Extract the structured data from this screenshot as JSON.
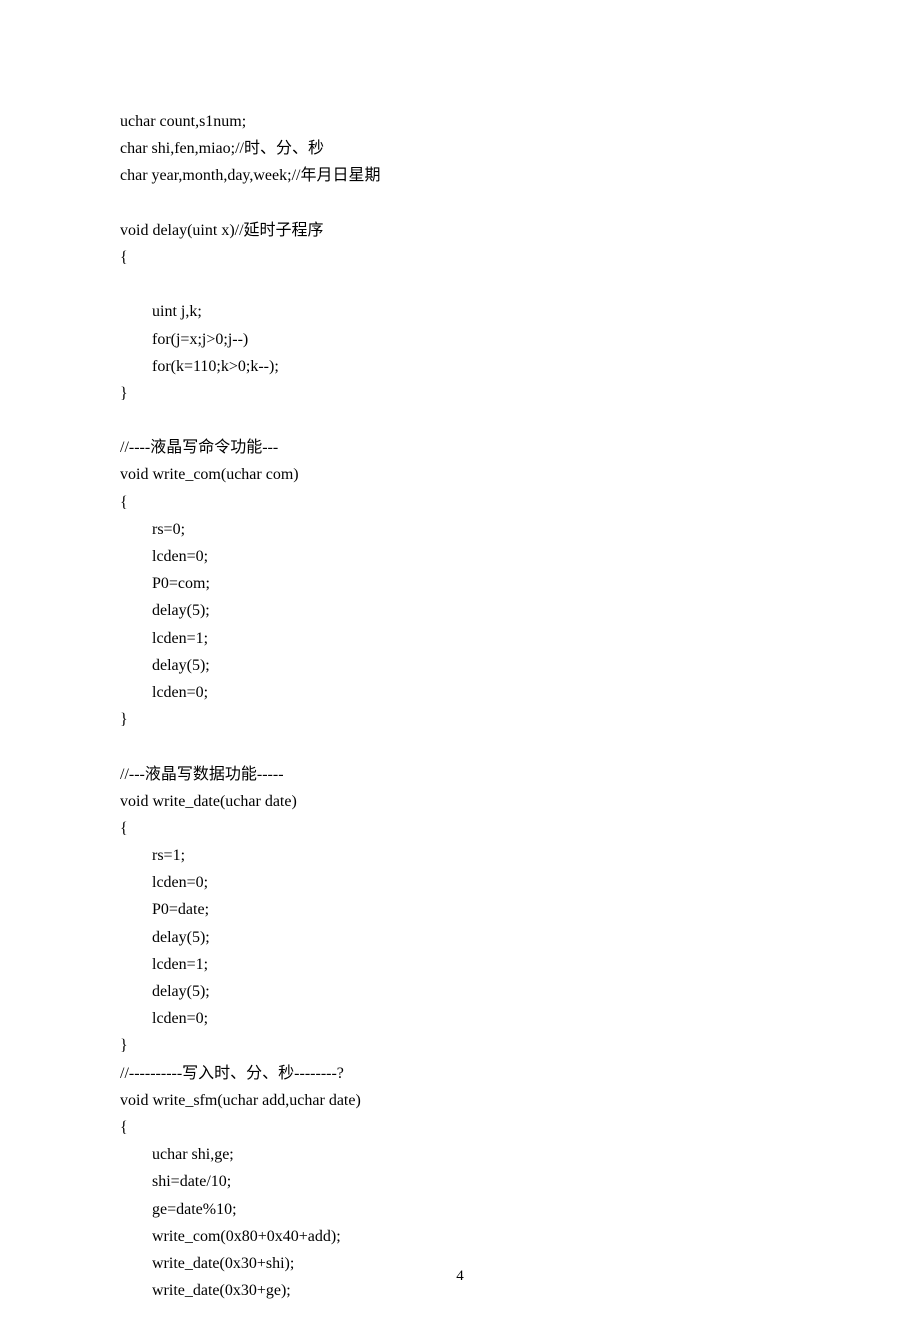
{
  "lines": [
    "uchar count,s1num;",
    "char shi,fen,miao;//时、分、秒",
    "char year,month,day,week;//年月日星期",
    "",
    "void delay(uint x)//延时子程序",
    "{",
    "",
    "        uint j,k;",
    "        for(j=x;j>0;j--)",
    "        for(k=110;k>0;k--);",
    "}",
    "",
    "//----液晶写命令功能---",
    "void write_com(uchar com)",
    "{",
    "        rs=0;",
    "        lcden=0;",
    "        P0=com;",
    "        delay(5);",
    "        lcden=1;",
    "        delay(5);",
    "        lcden=0;",
    "}",
    "",
    "//---液晶写数据功能-----",
    "void write_date(uchar date)",
    "{",
    "        rs=1;",
    "        lcden=0;",
    "        P0=date;",
    "        delay(5);",
    "        lcden=1;",
    "        delay(5);",
    "        lcden=0;",
    "}",
    "//----------写入时、分、秒--------?",
    "void write_sfm(uchar add,uchar date)",
    "{",
    "        uchar shi,ge;",
    "        shi=date/10;",
    "        ge=date%10;",
    "        write_com(0x80+0x40+add);",
    "        write_date(0x30+shi);",
    "        write_date(0x30+ge);"
  ],
  "page_number": "4"
}
